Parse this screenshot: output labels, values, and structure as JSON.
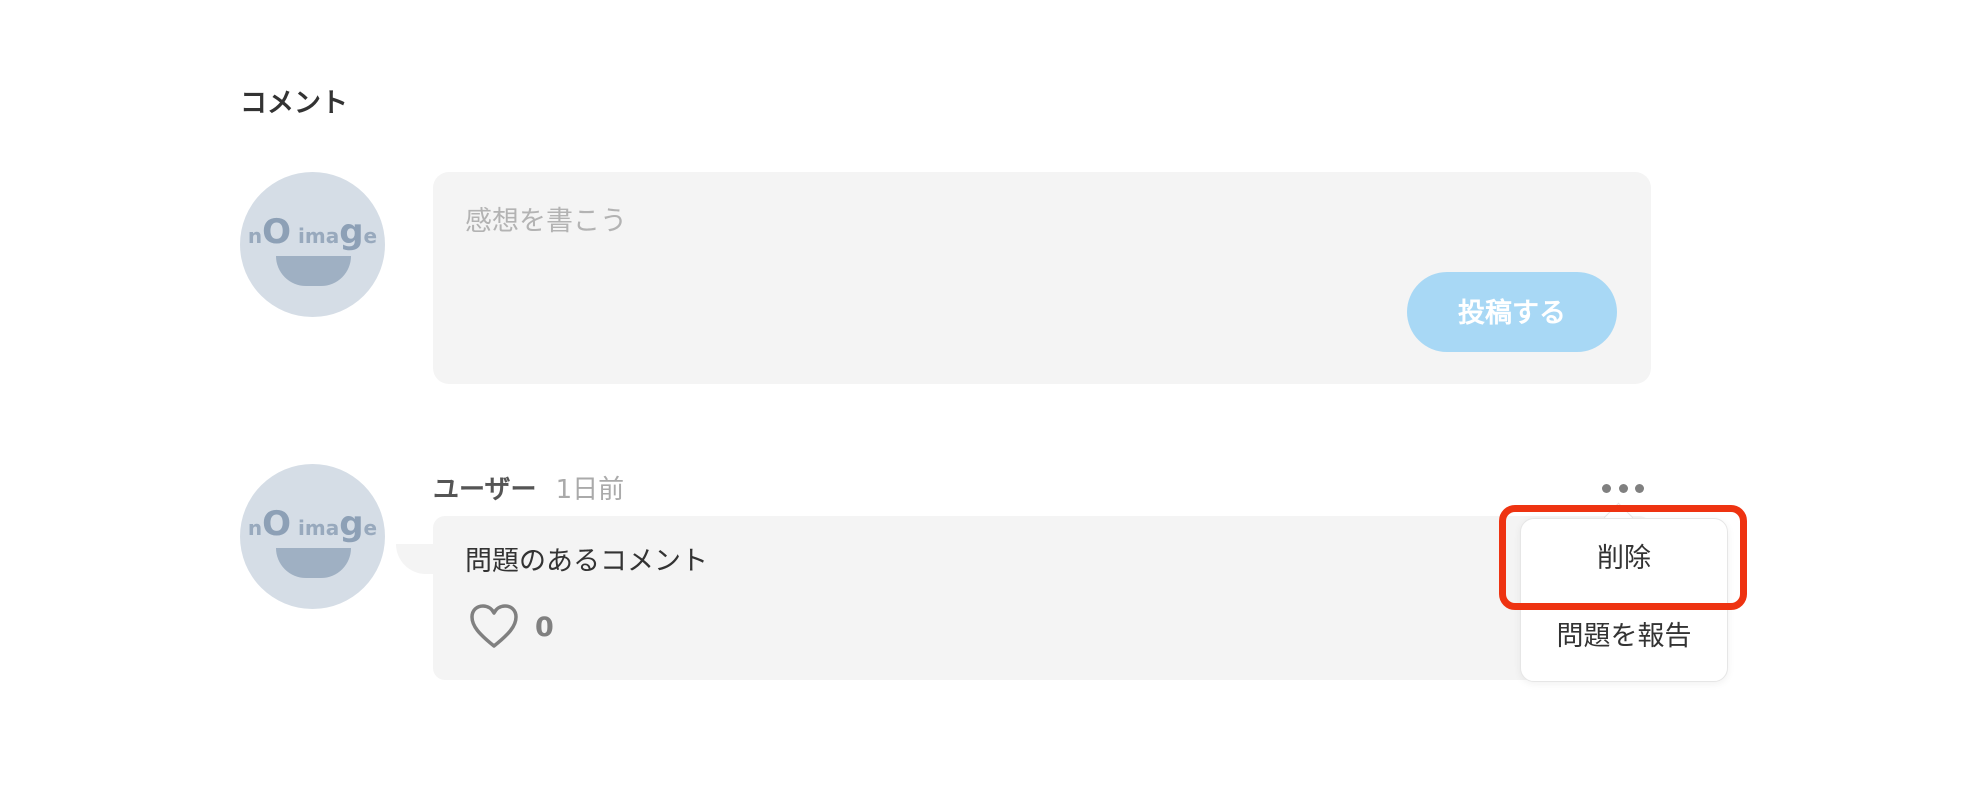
{
  "section": {
    "title": "コメント"
  },
  "avatar": {
    "text_left": "n",
    "text_o": "O",
    "text_mid": " ima",
    "text_g": "g",
    "text_end": "e",
    "icon": "no-image-avatar"
  },
  "compose": {
    "placeholder": "感想を書こう",
    "post_label": "投稿する",
    "post_color": "#a8d8f5"
  },
  "comment": {
    "user": "ユーザー",
    "time": "1日前",
    "text": "問題のあるコメント",
    "likes": "0",
    "like_icon": "heart-icon",
    "more_icon": "more-horizontal-icon"
  },
  "menu": {
    "items": [
      {
        "label": "削除"
      },
      {
        "label": "問題を報告"
      }
    ],
    "highlight_color": "#ee3311"
  }
}
